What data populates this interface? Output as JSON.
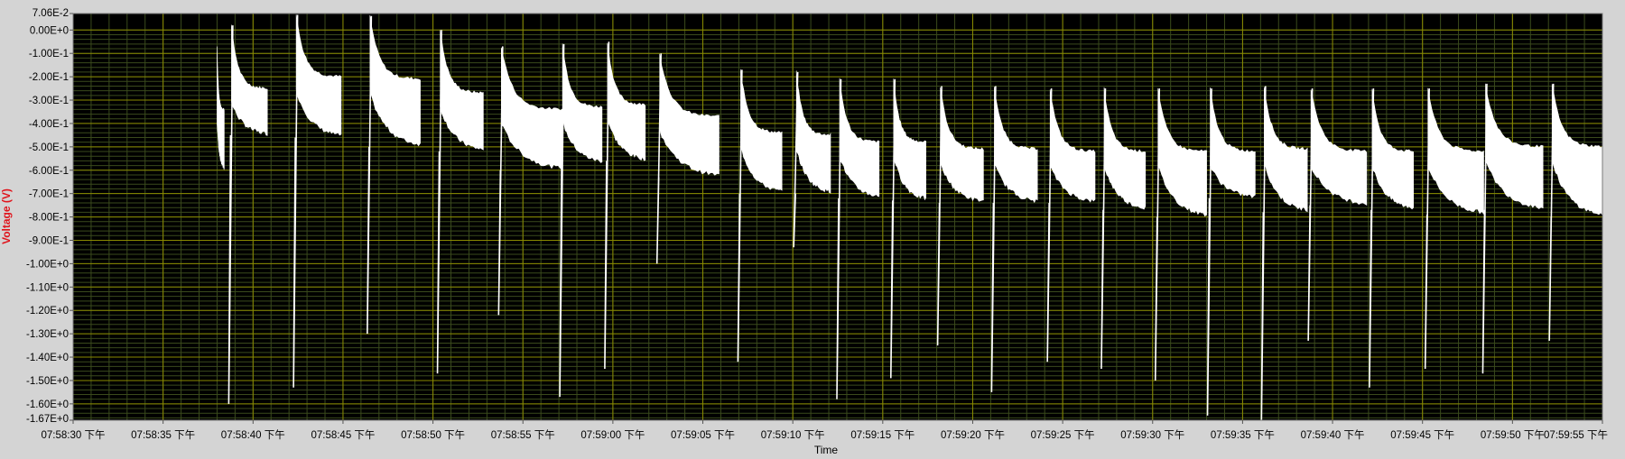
{
  "colors": {
    "background": "#d4d4d4",
    "plot_background": "#000000",
    "major_grid": "#8a8a00",
    "minor_grid": "#3a4a1c",
    "trace": "#ffffff",
    "ylabel": "#e0141c",
    "tick_text": "#000000"
  },
  "chart_data": {
    "type": "line",
    "title": "",
    "xlabel": "Time",
    "ylabel": "Voltage (V)",
    "grid": true,
    "legend": "none",
    "xlim": [
      "07:58:30",
      "07:59:55"
    ],
    "ylim": [
      -1.67,
      0.0706
    ],
    "x_tick_labels": [
      "07:58:30 下午",
      "07:58:35 下午",
      "07:58:40 下午",
      "07:58:45 下午",
      "07:58:50 下午",
      "07:58:55 下午",
      "07:59:00 下午",
      "07:59:05 下午",
      "07:59:10 下午",
      "07:59:15 下午",
      "07:59:20 下午",
      "07:59:25 下午",
      "07:59:30 下午",
      "07:59:35 下午",
      "07:59:40 下午",
      "07:59:45 下午",
      "07:59:50 下午",
      "07:59:55 下午"
    ],
    "y_ticks": [
      {
        "value": 0.0706,
        "label": "7.06E-2"
      },
      {
        "value": 0.0,
        "label": "0.00E+0"
      },
      {
        "value": -0.1,
        "label": "-1.00E-1"
      },
      {
        "value": -0.2,
        "label": "-2.00E-1"
      },
      {
        "value": -0.3,
        "label": "-3.00E-1"
      },
      {
        "value": -0.4,
        "label": "-4.00E-1"
      },
      {
        "value": -0.5,
        "label": "-5.00E-1"
      },
      {
        "value": -0.6,
        "label": "-6.00E-1"
      },
      {
        "value": -0.7,
        "label": "-7.00E-1"
      },
      {
        "value": -0.8,
        "label": "-8.00E-1"
      },
      {
        "value": -0.9,
        "label": "-9.00E-1"
      },
      {
        "value": -1.0,
        "label": "-1.00E+0"
      },
      {
        "value": -1.1,
        "label": "-1.10E+0"
      },
      {
        "value": -1.2,
        "label": "-1.20E+0"
      },
      {
        "value": -1.3,
        "label": "-1.30E+0"
      },
      {
        "value": -1.4,
        "label": "-1.40E+0"
      },
      {
        "value": -1.5,
        "label": "-1.50E+0"
      },
      {
        "value": -1.6,
        "label": "-1.60E+0"
      },
      {
        "value": -1.67,
        "label": "-1.67E+0"
      }
    ],
    "series": [
      {
        "segments": [
          {
            "start": "07:58:38.0",
            "end": "07:58:38.4",
            "top": -0.34,
            "bottom": -0.6,
            "dip": null
          },
          {
            "start": "07:58:38.8",
            "end": "07:58:40.8",
            "top": -0.25,
            "bottom": -0.45,
            "dip": -1.6
          },
          {
            "start": "07:58:42.4",
            "end": "07:58:44.9",
            "top": -0.2,
            "bottom": -0.46,
            "dip": -1.53
          },
          {
            "start": "07:58:46.5",
            "end": "07:58:49.3",
            "top": -0.21,
            "bottom": -0.5,
            "dip": -1.3
          },
          {
            "start": "07:58:50.4",
            "end": "07:58:52.8",
            "top": -0.27,
            "bottom": -0.52,
            "dip": -1.47
          },
          {
            "start": "07:58:53.8",
            "end": "07:58:57.2",
            "top": -0.34,
            "bottom": -0.6,
            "dip": -1.22
          },
          {
            "start": "07:58:57.2",
            "end": "07:58:59.4",
            "top": -0.33,
            "bottom": -0.57,
            "dip": -1.57
          },
          {
            "start": "07:58:59.7",
            "end": "07:59:01.8",
            "top": -0.32,
            "bottom": -0.56,
            "dip": -1.45
          },
          {
            "start": "07:59:02.6",
            "end": "07:59:05.9",
            "top": -0.37,
            "bottom": -0.63,
            "dip": -1.0
          },
          {
            "start": "07:59:07.1",
            "end": "07:59:09.4",
            "top": -0.44,
            "bottom": -0.7,
            "dip": -1.42
          },
          {
            "start": "07:59:10.2",
            "end": "07:59:12.1",
            "top": -0.45,
            "bottom": -0.7,
            "dip": -0.93
          },
          {
            "start": "07:59:12.6",
            "end": "07:59:14.8",
            "top": -0.48,
            "bottom": -0.72,
            "dip": -1.58
          },
          {
            "start": "07:59:15.6",
            "end": "07:59:17.4",
            "top": -0.48,
            "bottom": -0.73,
            "dip": -1.49
          },
          {
            "start": "07:59:18.2",
            "end": "07:59:20.6",
            "top": -0.51,
            "bottom": -0.74,
            "dip": -1.35
          },
          {
            "start": "07:59:21.2",
            "end": "07:59:23.6",
            "top": -0.51,
            "bottom": -0.74,
            "dip": -1.55
          },
          {
            "start": "07:59:24.3",
            "end": "07:59:26.8",
            "top": -0.52,
            "bottom": -0.74,
            "dip": -1.42
          },
          {
            "start": "07:59:27.3",
            "end": "07:59:29.6",
            "top": -0.52,
            "bottom": -0.77,
            "dip": -1.45
          },
          {
            "start": "07:59:30.3",
            "end": "07:59:33.0",
            "top": -0.52,
            "bottom": -0.8,
            "dip": -1.5
          },
          {
            "start": "07:59:33.2",
            "end": "07:59:35.7",
            "top": -0.52,
            "bottom": -0.72,
            "dip": -1.65
          },
          {
            "start": "07:59:36.2",
            "end": "07:59:38.6",
            "top": -0.51,
            "bottom": -0.78,
            "dip": -1.67
          },
          {
            "start": "07:59:38.8",
            "end": "07:59:41.9",
            "top": -0.52,
            "bottom": -0.75,
            "dip": -1.33
          },
          {
            "start": "07:59:42.2",
            "end": "07:59:44.5",
            "top": -0.52,
            "bottom": -0.77,
            "dip": -1.53
          },
          {
            "start": "07:59:45.3",
            "end": "07:59:48.4",
            "top": -0.52,
            "bottom": -0.79,
            "dip": -1.45
          },
          {
            "start": "07:59:48.5",
            "end": "07:59:51.7",
            "top": -0.5,
            "bottom": -0.77,
            "dip": -1.47
          },
          {
            "start": "07:59:52.2",
            "end": "07:59:55.0",
            "top": -0.5,
            "bottom": -0.8,
            "dip": -1.33
          }
        ]
      }
    ]
  }
}
